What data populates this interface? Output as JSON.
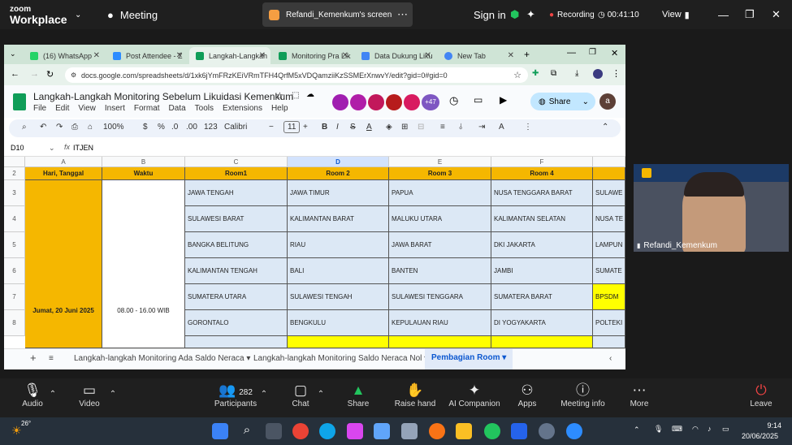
{
  "zoom": {
    "logo_top": "zoom",
    "logo_bottom": "Workplace",
    "meeting_label": "Meeting",
    "share_title": "Refandi_Kemenkum's screen",
    "signin": "Sign in",
    "recording_label": "Recording",
    "timer": "00:41:10",
    "view_label": "View"
  },
  "browser": {
    "tabs": [
      "(16) WhatsApp",
      "Post Attendee - Z",
      "Langkah-Langkah",
      "Monitoring Pra Lik",
      "Data Dukung Liku",
      "New Tab"
    ],
    "url": "docs.google.com/spreadsheets/d/1xk6jYmFRzKEiVRmTFH4QrfM5xVDQamziiKzSSMErXnwvY/edit?gid=0#gid=0"
  },
  "sheet": {
    "title": "Langkah-Langkah Monitoring Sebelum Likuidasi Kemenkum",
    "menus": [
      "File",
      "Edit",
      "View",
      "Insert",
      "Format",
      "Data",
      "Tools",
      "Extensions",
      "Help"
    ],
    "share_label": "Share",
    "presence_count": "+47",
    "avatar_letter": "a",
    "zoom_level": "100%",
    "font_name": "Calibri",
    "font_size": "11",
    "cell_ref": "D10",
    "formula_value": "ITJEN",
    "columns": [
      "A",
      "B",
      "C",
      "D",
      "E",
      "F"
    ],
    "rows": [
      "2",
      "3",
      "4",
      "5",
      "6",
      "7",
      "8"
    ],
    "header": [
      "Hari, Tanggal",
      "Waktu",
      "Room1",
      "Room 2",
      "Room 3",
      "Room 4"
    ],
    "date_cell": "Jumat, 20 Juni 2025",
    "time_cell": "08.00 - 16.00 WIB",
    "room_rows": [
      [
        "JAWA TENGAH",
        "JAWA TIMUR",
        "PAPUA",
        "NUSA TENGGARA BARAT",
        "SULAWE"
      ],
      [
        "SULAWESI BARAT",
        "KALIMANTAN BARAT",
        "MALUKU UTARA",
        "KALIMANTAN SELATAN",
        "NUSA TE"
      ],
      [
        "BANGKA BELITUNG",
        "RIAU",
        "JAWA BARAT",
        "DKI JAKARTA",
        "LAMPUN"
      ],
      [
        "KALIMANTAN TENGAH",
        "BALI",
        "BANTEN",
        "JAMBI",
        "SUMATE"
      ],
      [
        "SUMATERA UTARA",
        "SULAWESI TENGAH",
        "SULAWESI TENGGARA",
        "SUMATERA BARAT",
        "BPSDM"
      ],
      [
        "GORONTALO",
        "BENGKULU",
        "KEPULAUAN RIAU",
        "DI YOGYAKARTA",
        "POLTEKI"
      ]
    ],
    "sheet_tabs": [
      "Langkah-langkah Monitoring Ada Saldo Neraca",
      "Langkah-langkah Monitoring Saldo Neraca Nol",
      "Pembagian Room"
    ]
  },
  "video": {
    "name": "Refandi_Kemenkum"
  },
  "controls": {
    "audio": "Audio",
    "video": "Video",
    "participants": "Participants",
    "participants_count": "282",
    "chat": "Chat",
    "share": "Share",
    "raise": "Raise hand",
    "ai": "AI Companion",
    "apps": "Apps",
    "info": "Meeting info",
    "more": "More",
    "leave": "Leave"
  },
  "taskbar": {
    "temp": "26°",
    "time": "9:14",
    "date": "20/06/2025"
  }
}
